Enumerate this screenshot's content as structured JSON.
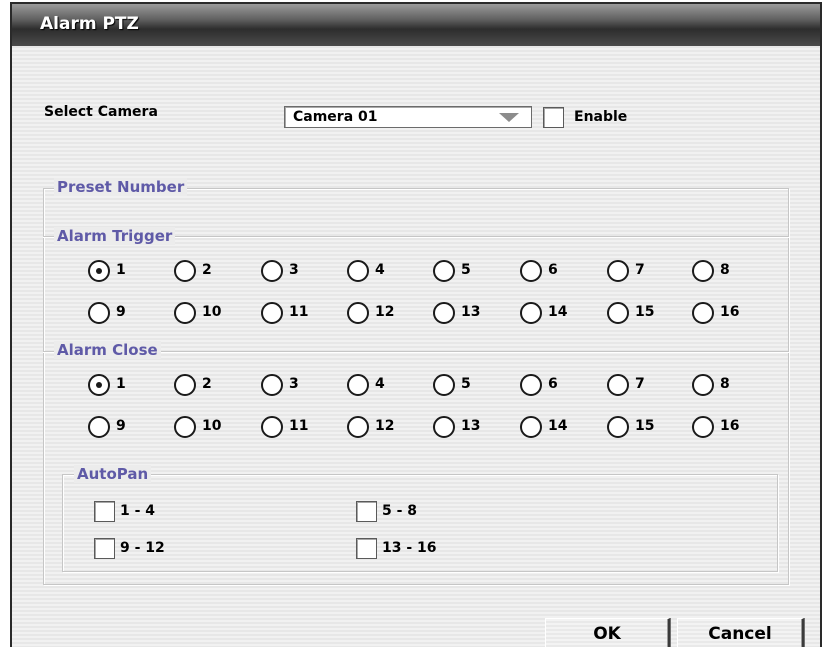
{
  "window": {
    "title": "Alarm PTZ"
  },
  "camera": {
    "label": "Select Camera",
    "selected": "Camera 01",
    "enable_label": "Enable",
    "enabled": false
  },
  "preset_number": {
    "title": "Preset Number"
  },
  "alarm_trigger": {
    "title": "Alarm Trigger",
    "options": [
      "1",
      "2",
      "3",
      "4",
      "5",
      "6",
      "7",
      "8",
      "9",
      "10",
      "11",
      "12",
      "13",
      "14",
      "15",
      "16"
    ],
    "selected": "1"
  },
  "alarm_close": {
    "title": "Alarm Close",
    "options": [
      "1",
      "2",
      "3",
      "4",
      "5",
      "6",
      "7",
      "8",
      "9",
      "10",
      "11",
      "12",
      "13",
      "14",
      "15",
      "16"
    ],
    "selected": "1"
  },
  "autopan": {
    "title": "AutoPan",
    "items": [
      {
        "label": "1 - 4",
        "checked": false
      },
      {
        "label": "5 - 8",
        "checked": false
      },
      {
        "label": "9 - 12",
        "checked": false
      },
      {
        "label": "13 - 16",
        "checked": false
      }
    ]
  },
  "buttons": {
    "ok": "OK",
    "cancel": "Cancel"
  }
}
